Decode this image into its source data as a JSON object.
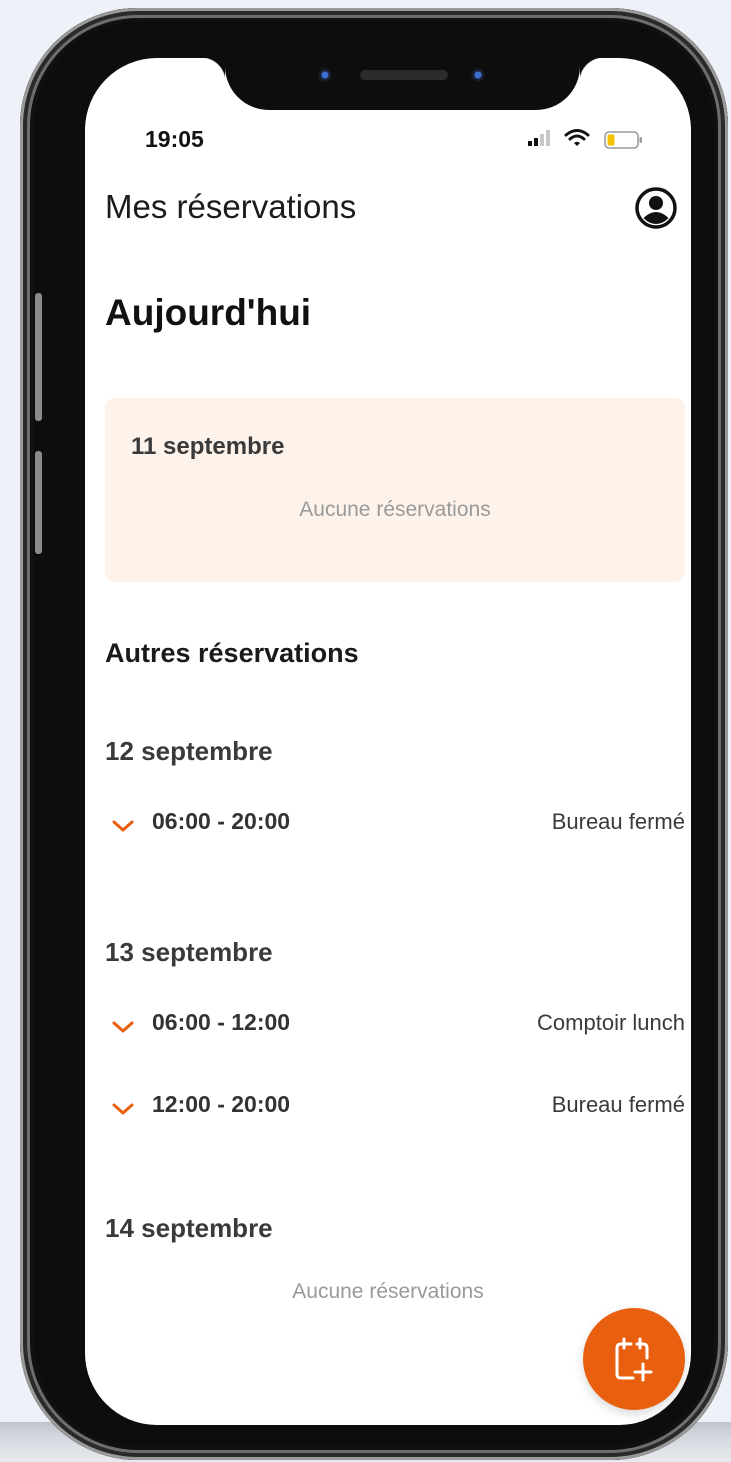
{
  "status_bar": {
    "time": "19:05"
  },
  "header": {
    "title": "Mes réservations",
    "profile_icon": "profile-circle-icon"
  },
  "today": {
    "heading": "Aujourd'hui",
    "date": "11 septembre",
    "empty_text": "Aucune réservations"
  },
  "others": {
    "heading": "Autres réservations",
    "days": [
      {
        "date": "12 septembre",
        "slots": [
          {
            "time": "06:00 - 20:00",
            "place": "Bureau fermé"
          }
        ]
      },
      {
        "date": "13 septembre",
        "slots": [
          {
            "time": "06:00 - 12:00",
            "place": "Comptoir lunch"
          },
          {
            "time": "12:00 - 20:00",
            "place": "Bureau fermé"
          }
        ]
      },
      {
        "date": "14 septembre",
        "empty_text": "Aucune réservations"
      }
    ]
  },
  "fab": {
    "icon": "calendar-add-icon"
  },
  "colors": {
    "accent": "#e8600f",
    "today_card_bg": "#fdf3eb"
  }
}
